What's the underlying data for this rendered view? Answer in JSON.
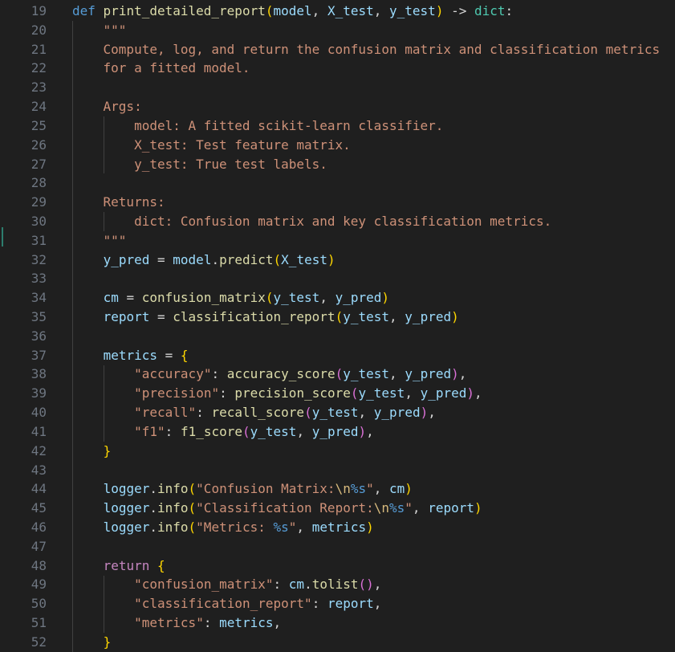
{
  "editor": {
    "lines": [
      {
        "number": "19",
        "text": "def print_detailed_report(model, X_test, y_test) -> dict:"
      },
      {
        "number": "20",
        "text": "    \"\"\""
      },
      {
        "number": "21",
        "text": "    Compute, log, and return the confusion matrix and classification metrics"
      },
      {
        "number": "22",
        "text": "    for a fitted model."
      },
      {
        "number": "23",
        "text": ""
      },
      {
        "number": "24",
        "text": "    Args:"
      },
      {
        "number": "25",
        "text": "        model: A fitted scikit-learn classifier."
      },
      {
        "number": "26",
        "text": "        X_test: Test feature matrix."
      },
      {
        "number": "27",
        "text": "        y_test: True test labels."
      },
      {
        "number": "28",
        "text": ""
      },
      {
        "number": "29",
        "text": "    Returns:"
      },
      {
        "number": "30",
        "text": "        dict: Confusion matrix and key classification metrics."
      },
      {
        "number": "31",
        "text": "    \"\"\""
      },
      {
        "number": "32",
        "text": "    y_pred = model.predict(X_test)"
      },
      {
        "number": "33",
        "text": ""
      },
      {
        "number": "34",
        "text": "    cm = confusion_matrix(y_test, y_pred)"
      },
      {
        "number": "35",
        "text": "    report = classification_report(y_test, y_pred)"
      },
      {
        "number": "36",
        "text": ""
      },
      {
        "number": "37",
        "text": "    metrics = {"
      },
      {
        "number": "38",
        "text": "        \"accuracy\": accuracy_score(y_test, y_pred),"
      },
      {
        "number": "39",
        "text": "        \"precision\": precision_score(y_test, y_pred),"
      },
      {
        "number": "40",
        "text": "        \"recall\": recall_score(y_test, y_pred),"
      },
      {
        "number": "41",
        "text": "        \"f1\": f1_score(y_test, y_pred),"
      },
      {
        "number": "42",
        "text": "    }"
      },
      {
        "number": "43",
        "text": ""
      },
      {
        "number": "44",
        "text": "    logger.info(\"Confusion Matrix:\\n%s\", cm)"
      },
      {
        "number": "45",
        "text": "    logger.info(\"Classification Report:\\n%s\", report)"
      },
      {
        "number": "46",
        "text": "    logger.info(\"Metrics: %s\", metrics)"
      },
      {
        "number": "47",
        "text": ""
      },
      {
        "number": "48",
        "text": "    return {"
      },
      {
        "number": "49",
        "text": "        \"confusion_matrix\": cm.tolist(),"
      },
      {
        "number": "50",
        "text": "        \"classification_report\": report,"
      },
      {
        "number": "51",
        "text": "        \"metrics\": metrics,"
      },
      {
        "number": "52",
        "text": "    }"
      }
    ]
  }
}
